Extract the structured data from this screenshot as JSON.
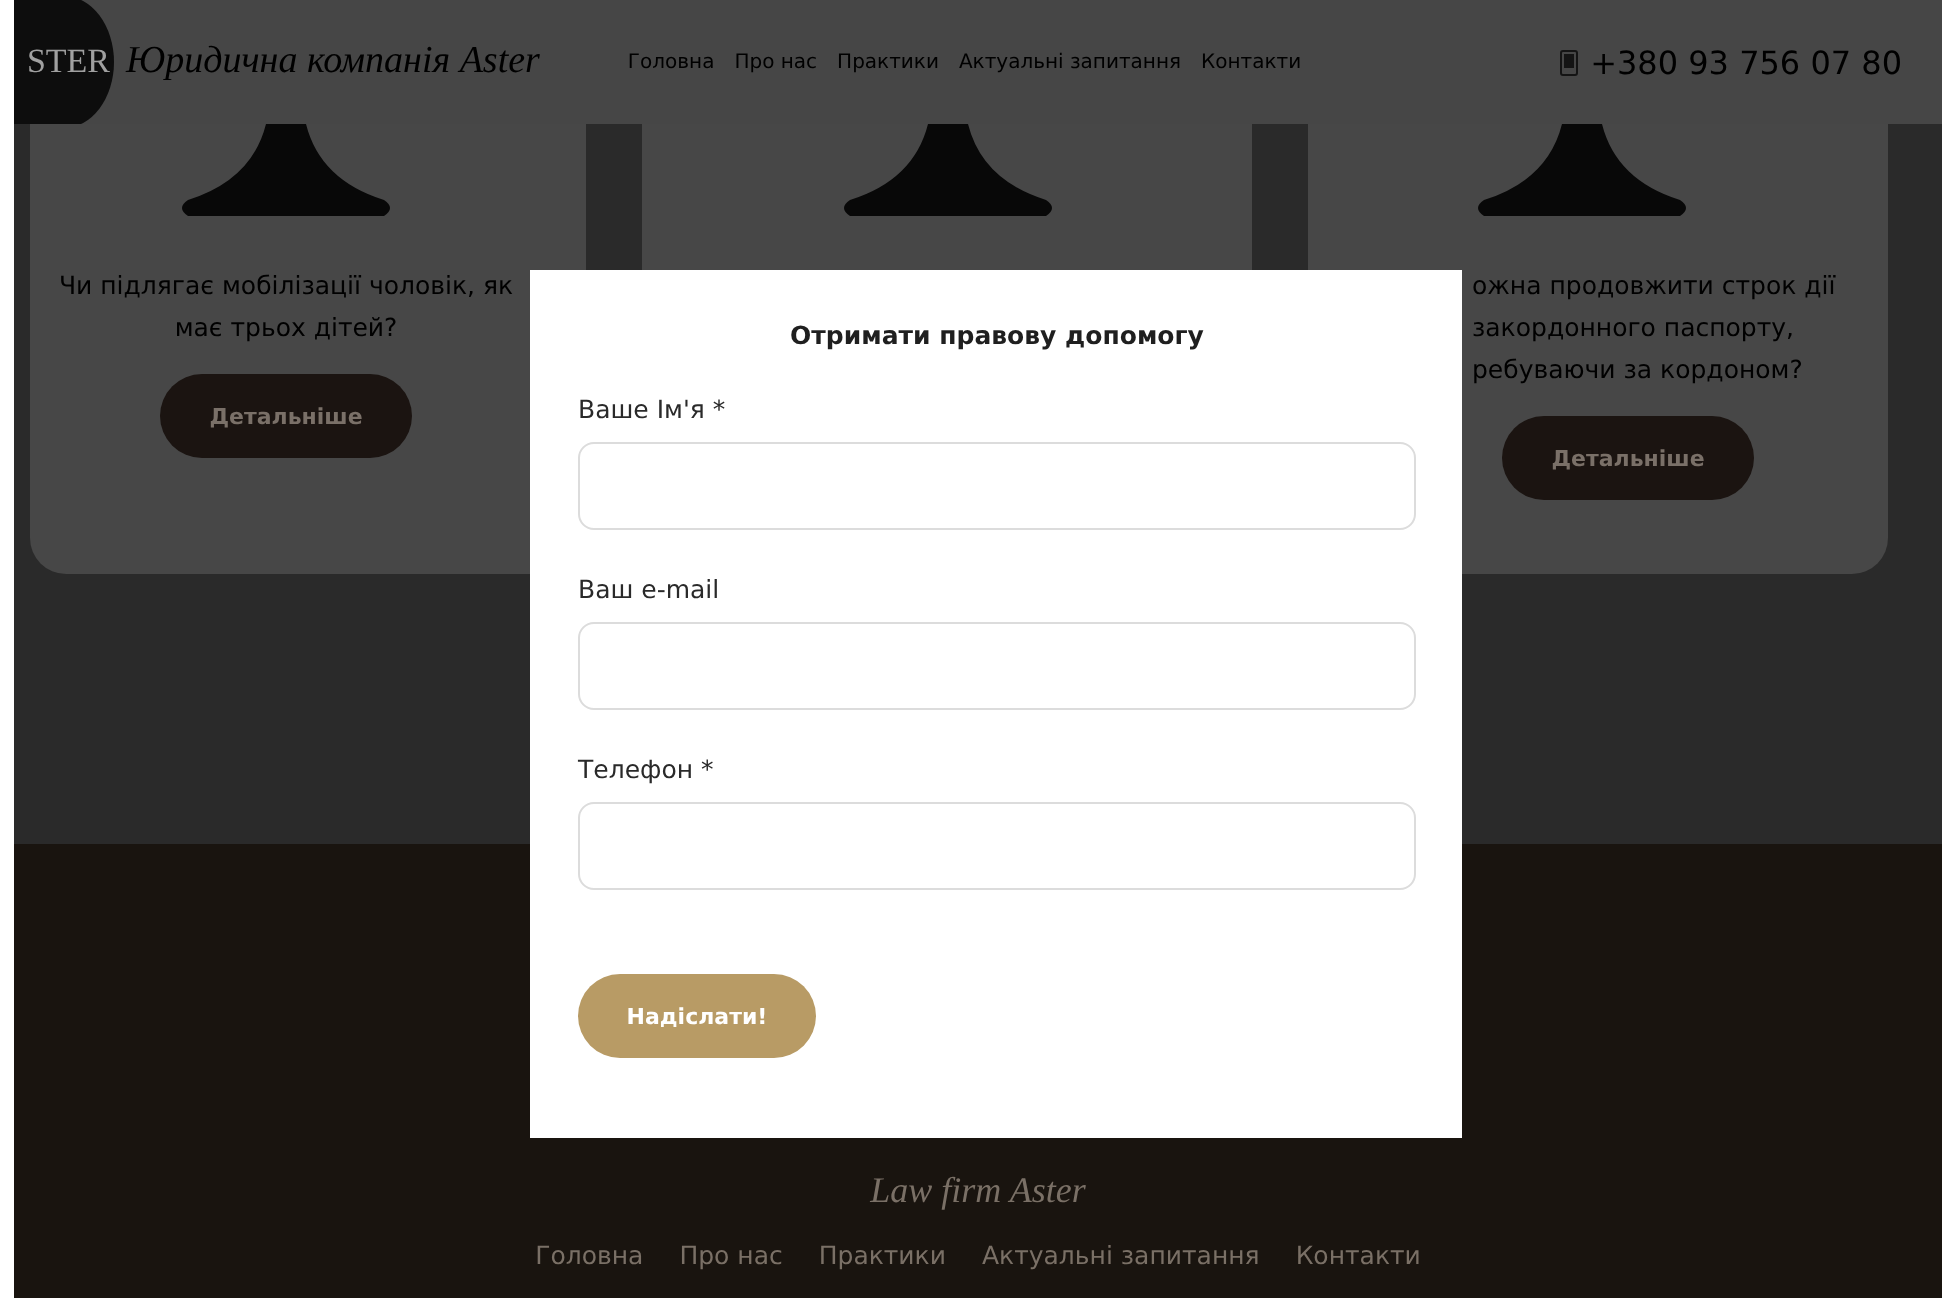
{
  "header": {
    "logo_text": "STER",
    "title": "Юридична компанія Aster",
    "nav": [
      "Головна",
      "Про нас",
      "Практики",
      "Актуальні запитання",
      "Контакти"
    ],
    "phone": "+380 93 756 07 80"
  },
  "cards": [
    {
      "question_lines": [
        "Чи підлягає мобілізації чоловік, як",
        "має трьох дітей?"
      ],
      "button": "Детальніше"
    },
    {
      "question_lines": [
        "ожна продовжити строк дії",
        "закордонного паспорту,",
        "ребуваючи за кордоном?"
      ],
      "button": "Детальніше"
    }
  ],
  "modal": {
    "title": "Отримати правову допомогу",
    "fields": [
      {
        "label": "Ваше Ім'я *"
      },
      {
        "label": "Ваш e-mail"
      },
      {
        "label": "Телефон *"
      }
    ],
    "submit": "Надіслати!"
  },
  "footer": {
    "brand": "Law firm Aster",
    "nav": [
      "Головна",
      "Про нас",
      "Практики",
      "Актуальні запитання",
      "Контакти"
    ]
  }
}
